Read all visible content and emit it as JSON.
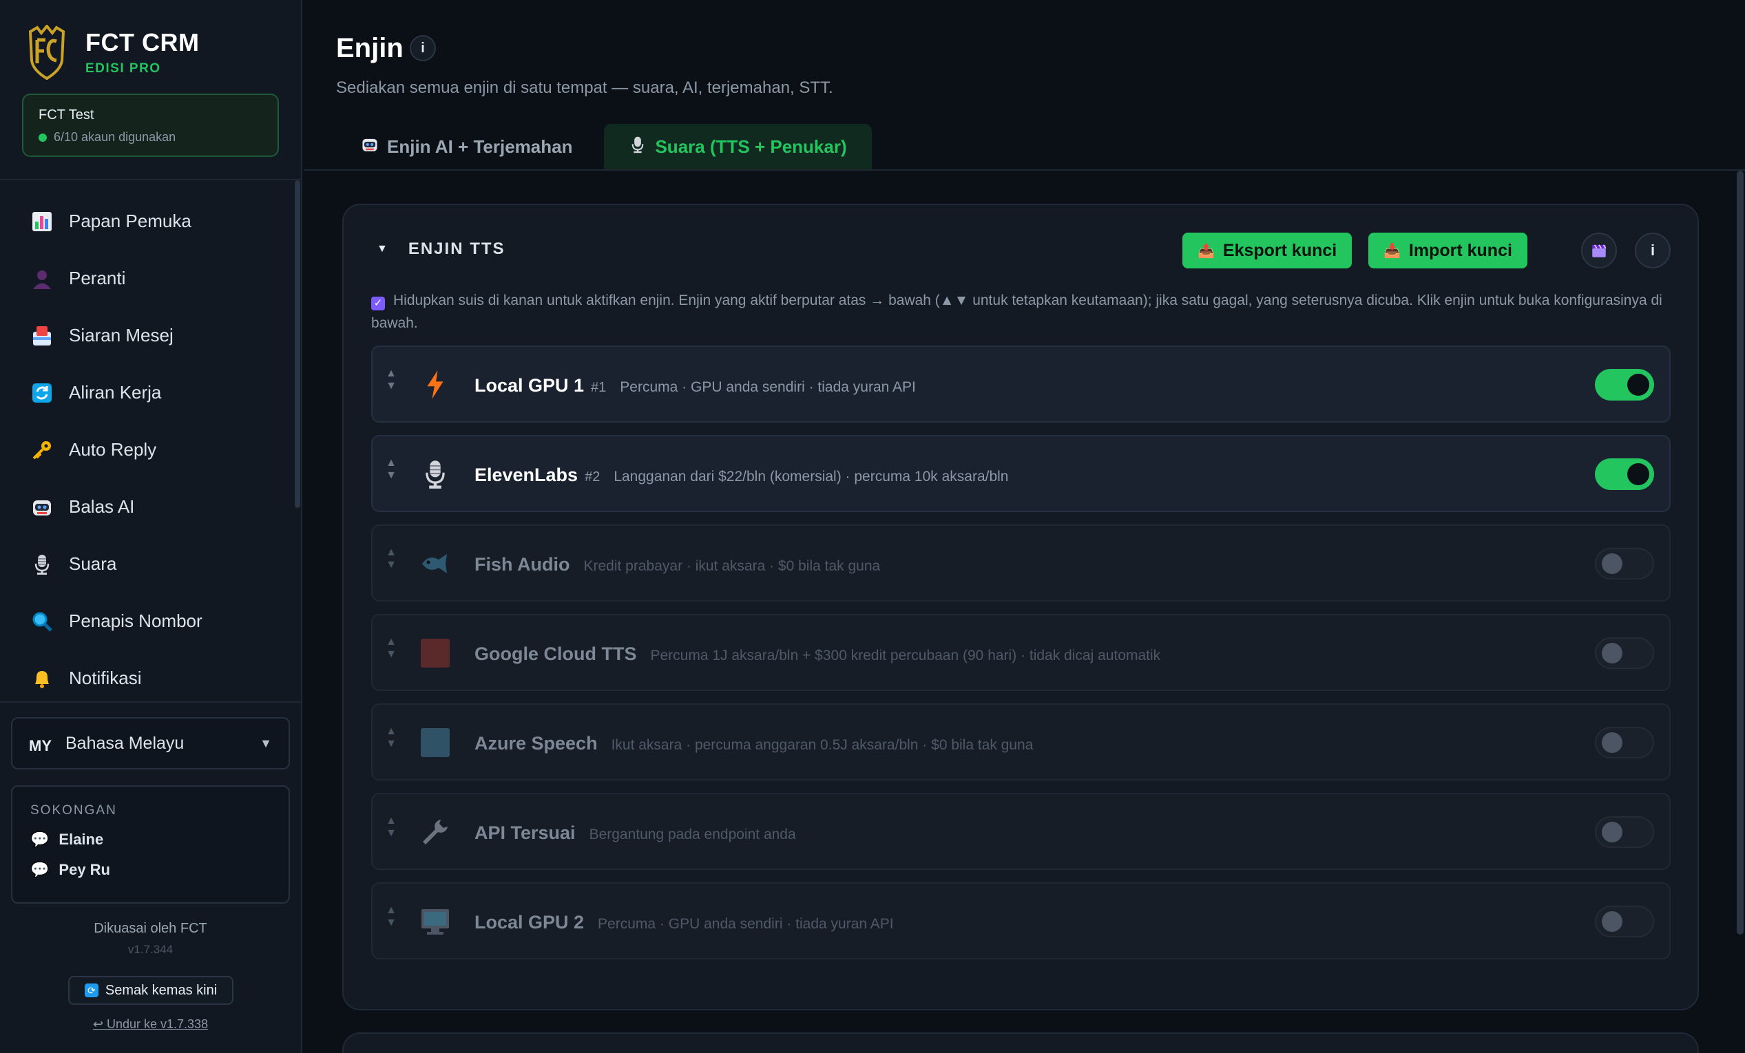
{
  "brand": {
    "name": "FCT CRM",
    "edition": "EDISI PRO"
  },
  "workspace": {
    "name": "FCT Test",
    "usage": "6/10 akaun digunakan"
  },
  "nav": [
    {
      "label": "Papan Pemuka",
      "icon": "chart-icon"
    },
    {
      "label": "Peranti",
      "icon": "user-icon"
    },
    {
      "label": "Siaran Mesej",
      "icon": "broadcast-icon"
    },
    {
      "label": "Aliran Kerja",
      "icon": "workflow-icon"
    },
    {
      "label": "Auto Reply",
      "icon": "key-icon"
    },
    {
      "label": "Balas AI",
      "icon": "robot-icon"
    },
    {
      "label": "Suara",
      "icon": "microphone-icon"
    },
    {
      "label": "Penapis Nombor",
      "icon": "magnifier-icon"
    },
    {
      "label": "Notifikasi",
      "icon": "bell-icon"
    }
  ],
  "language": {
    "code": "MY",
    "label": "Bahasa Melayu"
  },
  "support": {
    "title": "SOKONGAN",
    "contacts": [
      "Elaine",
      "Pey Ru"
    ]
  },
  "footer": {
    "powered": "Dikuasai oleh FCT",
    "version": "v1.7.344",
    "check_update": "Semak kemas kini",
    "downgrade": "↩ Undur ke v1.7.338"
  },
  "page": {
    "title": "Enjin",
    "subtitle": "Sediakan semua enjin di satu tempat — suara, AI, terjemahan, STT.",
    "tabs": [
      {
        "label": "Enjin AI + Terjemahan",
        "active": false
      },
      {
        "label": "Suara (TTS + Penukar)",
        "active": true
      }
    ]
  },
  "tts_section": {
    "title": "ENJIN TTS",
    "export_label": "Eksport kunci",
    "import_label": "Import kunci",
    "hint": "Hidupkan suis di kanan untuk aktifkan enjin. Enjin yang aktif berputar atas → bawah (▲▼ untuk tetapkan keutamaan); jika satu gagal, yang seterusnya dicuba. Klik enjin untuk buka konfigurasinya di bawah.",
    "engines": [
      {
        "name": "Local GPU 1",
        "rank": "#1",
        "desc": "Percuma · GPU anda sendiri · tiada yuran API",
        "enabled": true,
        "icon": "lightning-icon"
      },
      {
        "name": "ElevenLabs",
        "rank": "#2",
        "desc": "Langganan dari $22/bln (komersial) · percuma 10k aksara/bln",
        "enabled": true,
        "icon": "microphone-icon"
      },
      {
        "name": "Fish Audio",
        "rank": "",
        "desc": "Kredit prabayar · ikut aksara · $0 bila tak guna",
        "enabled": false,
        "icon": "fish-icon"
      },
      {
        "name": "Google Cloud TTS",
        "rank": "",
        "desc": "Percuma 1J aksara/bln + $300 kredit percubaan (90 hari) · tidak dicaj automatik",
        "enabled": false,
        "icon": "google-cloud-icon"
      },
      {
        "name": "Azure Speech",
        "rank": "",
        "desc": "Ikut aksara · percuma anggaran 0.5J aksara/bln · $0 bila tak guna",
        "enabled": false,
        "icon": "azure-icon"
      },
      {
        "name": "API Tersuai",
        "rank": "",
        "desc": "Bergantung pada endpoint anda",
        "enabled": false,
        "icon": "wrench-icon"
      },
      {
        "name": "Local GPU 2",
        "rank": "",
        "desc": "Percuma · GPU anda sendiri · tiada yuran API",
        "enabled": false,
        "icon": "monitor-icon"
      }
    ]
  },
  "colors": {
    "accent": "#22c55e",
    "background": "#0b0f16",
    "sidebar": "#111822",
    "card": "#131a24"
  }
}
